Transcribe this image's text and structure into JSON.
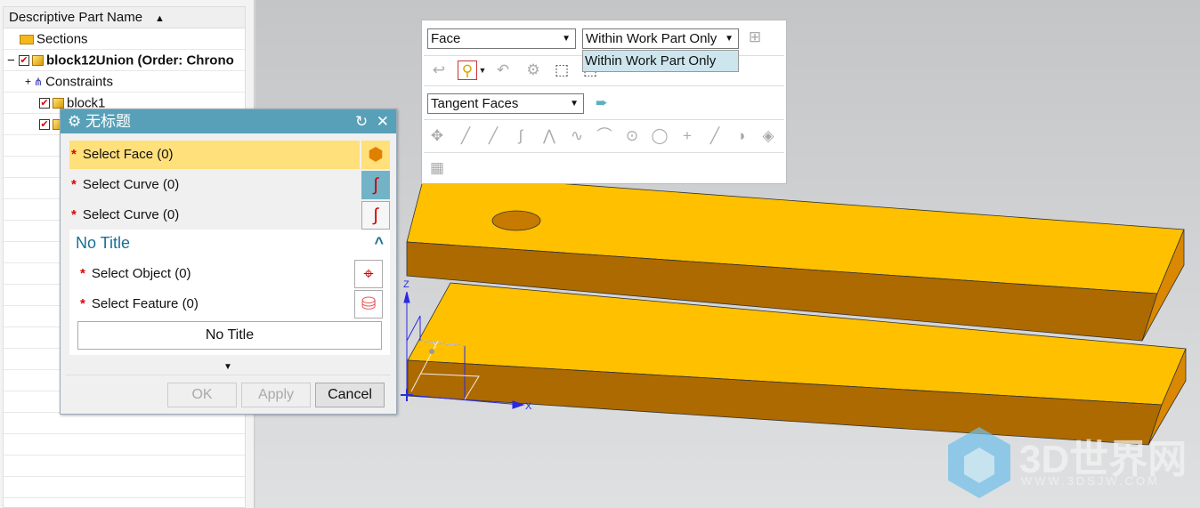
{
  "navigator": {
    "column_header": "Descriptive Part Name",
    "items": [
      {
        "label": "Sections",
        "icon": "folder-icon"
      },
      {
        "label": "block12Union (Order: Chrono",
        "icon": "assembly-icon",
        "checked": true,
        "expanded": true
      },
      {
        "label": "Constraints",
        "icon": "constraints-icon"
      },
      {
        "label": "block1",
        "icon": "part-icon",
        "checked": true
      },
      {
        "label": "",
        "icon": "part-icon",
        "checked": true
      }
    ]
  },
  "selection_bar": {
    "type_filter": "Face",
    "scope": "Within Work Part Only",
    "scope_menu_options": [
      "Within Work Part Only"
    ],
    "face_rule": "Tangent Faces"
  },
  "dialog": {
    "title": "无标题",
    "rows": [
      {
        "label": "Select Face (0)",
        "active": true
      },
      {
        "label": "Select Curve (0)"
      },
      {
        "label": "Select Curve (0)"
      }
    ],
    "group": {
      "title": "No Title",
      "rows": [
        {
          "label": "Select Object (0)"
        },
        {
          "label": "Select Feature (0)"
        }
      ],
      "button": "No Title"
    },
    "ok": "OK",
    "apply": "Apply",
    "cancel": "Cancel"
  },
  "viewport": {
    "axis_labels": {
      "x": "X",
      "y": "Y",
      "z": "Z"
    },
    "part_color": "#ffc000",
    "watermark": {
      "brand": "3D世界网",
      "url": "WWW.3DSJW.COM"
    }
  }
}
